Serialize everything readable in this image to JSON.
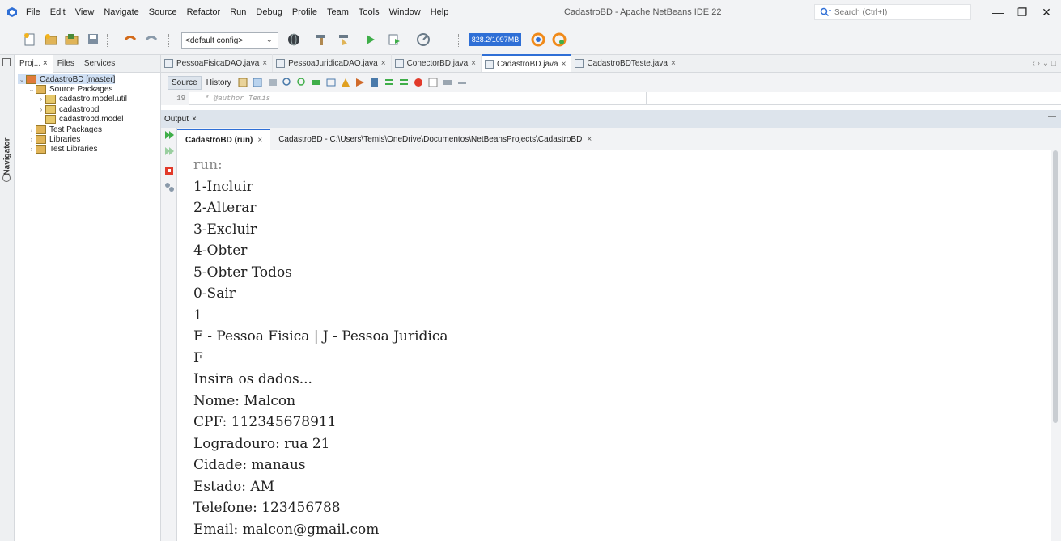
{
  "menu": {
    "items": [
      "File",
      "Edit",
      "View",
      "Navigate",
      "Source",
      "Refactor",
      "Run",
      "Debug",
      "Profile",
      "Team",
      "Tools",
      "Window",
      "Help"
    ],
    "window_title": "CadastroBD - Apache NetBeans IDE 22",
    "search_placeholder": "Search (Ctrl+I)",
    "window_controls": {
      "minimize": "—",
      "restore": "❐",
      "close": "✕"
    }
  },
  "toolbar": {
    "config": "<default config>",
    "memory": "828.2/1097MB"
  },
  "navigator": {
    "label": "Navigator"
  },
  "project_panel": {
    "tabs": [
      "Proj... ×",
      "Files",
      "Services"
    ],
    "tree": [
      {
        "label": "CadastroBD [master]",
        "level": 0,
        "arrow": "v",
        "icon": "project-icon"
      },
      {
        "label": "Source Packages",
        "level": 1,
        "arrow": "v",
        "icon": "folder-icon"
      },
      {
        "label": "cadastro.model.util",
        "level": 2,
        "arrow": ">",
        "icon": "package-icon"
      },
      {
        "label": "cadastrobd",
        "level": 2,
        "arrow": ">",
        "icon": "package-icon"
      },
      {
        "label": "cadastrobd.model",
        "level": 2,
        "arrow": "",
        "icon": "package-icon"
      },
      {
        "label": "Test Packages",
        "level": 1,
        "arrow": ">",
        "icon": "folder-icon"
      },
      {
        "label": "Libraries",
        "level": 1,
        "arrow": ">",
        "icon": "folder-icon"
      },
      {
        "label": "Test Libraries",
        "level": 1,
        "arrow": ">",
        "icon": "folder-icon"
      }
    ]
  },
  "editor": {
    "tabs": [
      "PessoaFisicaDAO.java",
      "PessoaJuridicaDAO.java",
      "ConectorBD.java",
      "CadastroBD.java",
      "CadastroBDTeste.java"
    ],
    "active_tab": "CadastroBD.java",
    "tab_close": "×",
    "tabs_nav": "‹ › ⌄ □",
    "view_tabs": [
      "Source",
      "History"
    ],
    "line_number": "19",
    "line_text": "* @author Temis"
  },
  "output": {
    "title": "Output",
    "close": "×",
    "minimize": "—",
    "tabs": [
      "CadastroBD (run)",
      "CadastroBD - C:\\Users\\Temis\\OneDrive\\Documentos\\NetBeansProjects\\CadastroBD"
    ],
    "lines": [
      "run:",
      "1-Incluir",
      "2-Alterar",
      "3-Excluir",
      "4-Obter",
      "5-Obter Todos",
      "0-Sair",
      "1",
      "F - Pessoa Fisica | J - Pessoa Juridica",
      "F",
      "Insira os dados...",
      "Nome: Malcon",
      "CPF: 112345678911",
      "Logradouro: rua 21",
      "Cidade: manaus",
      "Estado: AM",
      "Telefone: 123456788",
      "Email: malcon@gmail.com"
    ]
  },
  "colors": {
    "accent": "#2f6fd6",
    "chrome": "#f2f3f5",
    "output_header": "#dde4ec"
  }
}
